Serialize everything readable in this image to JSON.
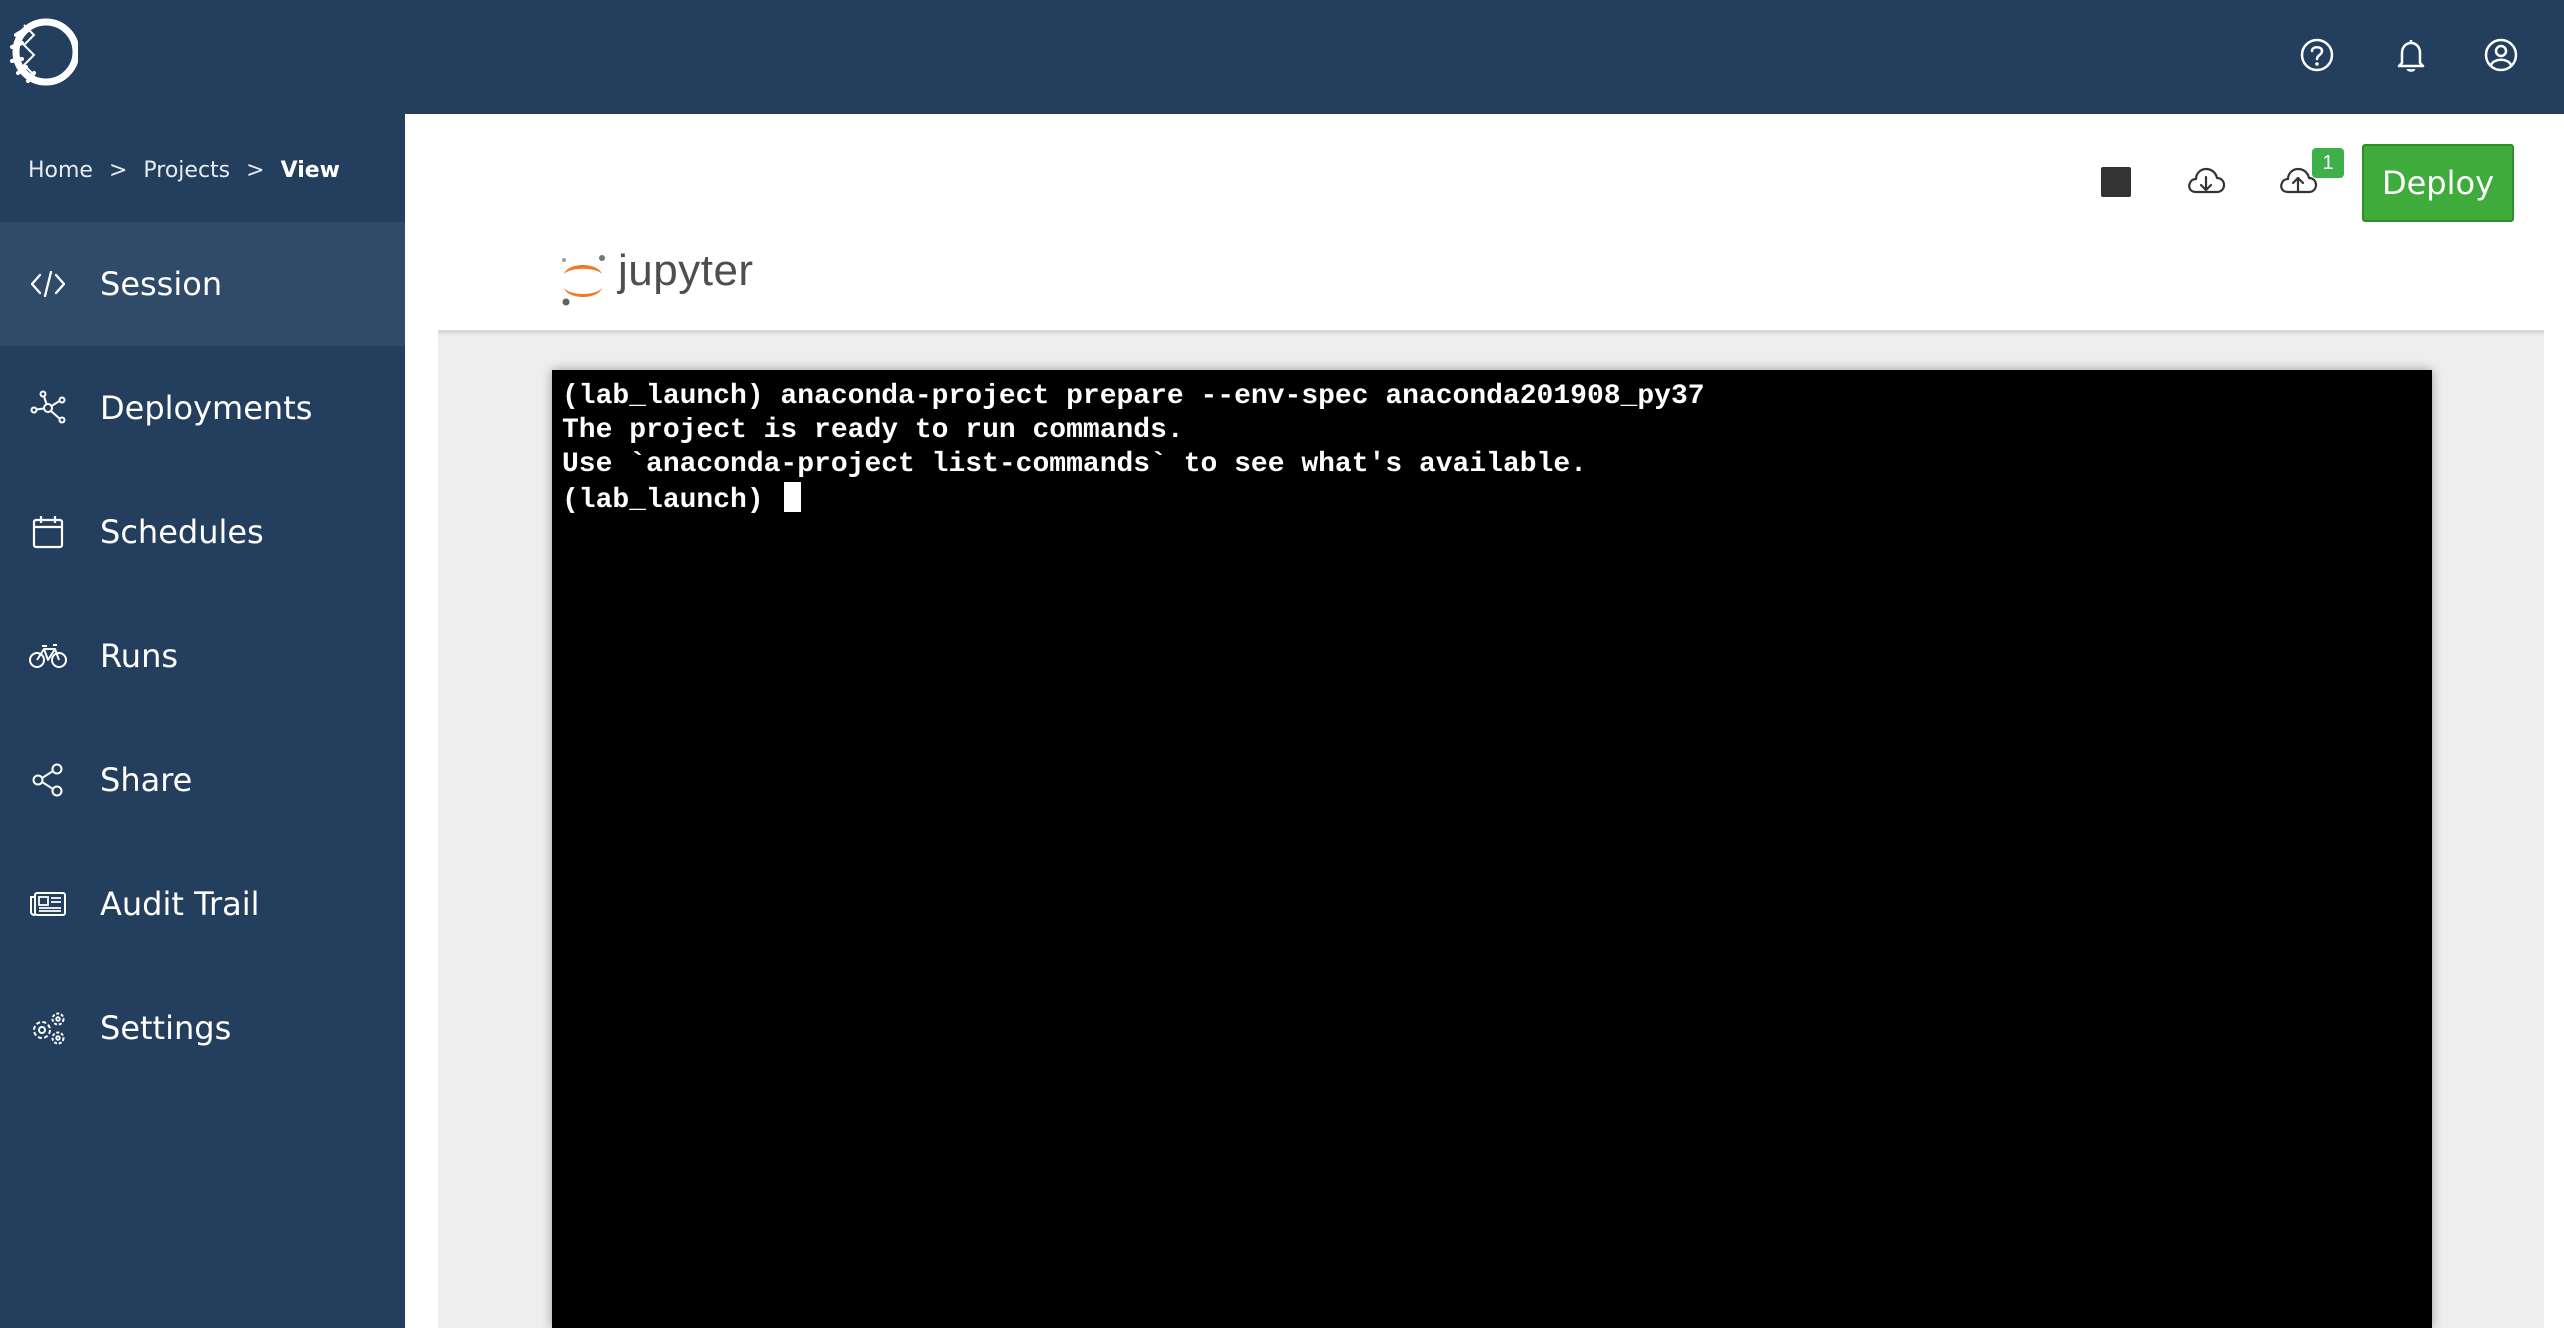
{
  "header": {
    "logo": "anaconda-logo",
    "icons": [
      "help-icon",
      "bell-icon",
      "user-icon"
    ]
  },
  "breadcrumb": {
    "items": [
      "Home",
      "Projects"
    ],
    "separator": ">",
    "current": "View"
  },
  "sidebar": {
    "items": [
      {
        "label": "Session",
        "icon": "code-icon",
        "active": true
      },
      {
        "label": "Deployments",
        "icon": "deployments-icon",
        "active": false
      },
      {
        "label": "Schedules",
        "icon": "calendar-icon",
        "active": false
      },
      {
        "label": "Runs",
        "icon": "bicycle-icon",
        "active": false
      },
      {
        "label": "Share",
        "icon": "share-icon",
        "active": false
      },
      {
        "label": "Audit Trail",
        "icon": "newspaper-icon",
        "active": false
      },
      {
        "label": "Settings",
        "icon": "gears-icon",
        "active": false
      }
    ]
  },
  "toolbar": {
    "stop_icon": "stop-icon",
    "download_icon": "cloud-download-icon",
    "upload_icon": "cloud-upload-icon",
    "upload_badge": "1",
    "deploy_label": "Deploy"
  },
  "jupyter": {
    "name": "jupyter"
  },
  "terminal": {
    "lines": [
      "(lab_launch) anaconda-project prepare --env-spec anaconda201908_py37",
      "The project is ready to run commands.",
      "Use `anaconda-project list-commands` to see what's available."
    ],
    "prompt": "(lab_launch) "
  },
  "colors": {
    "nav_bg": "#243e5e",
    "nav_active_bg": "#304a69",
    "deploy_green": "#3eab3b",
    "jupyter_orange": "#f37726"
  }
}
